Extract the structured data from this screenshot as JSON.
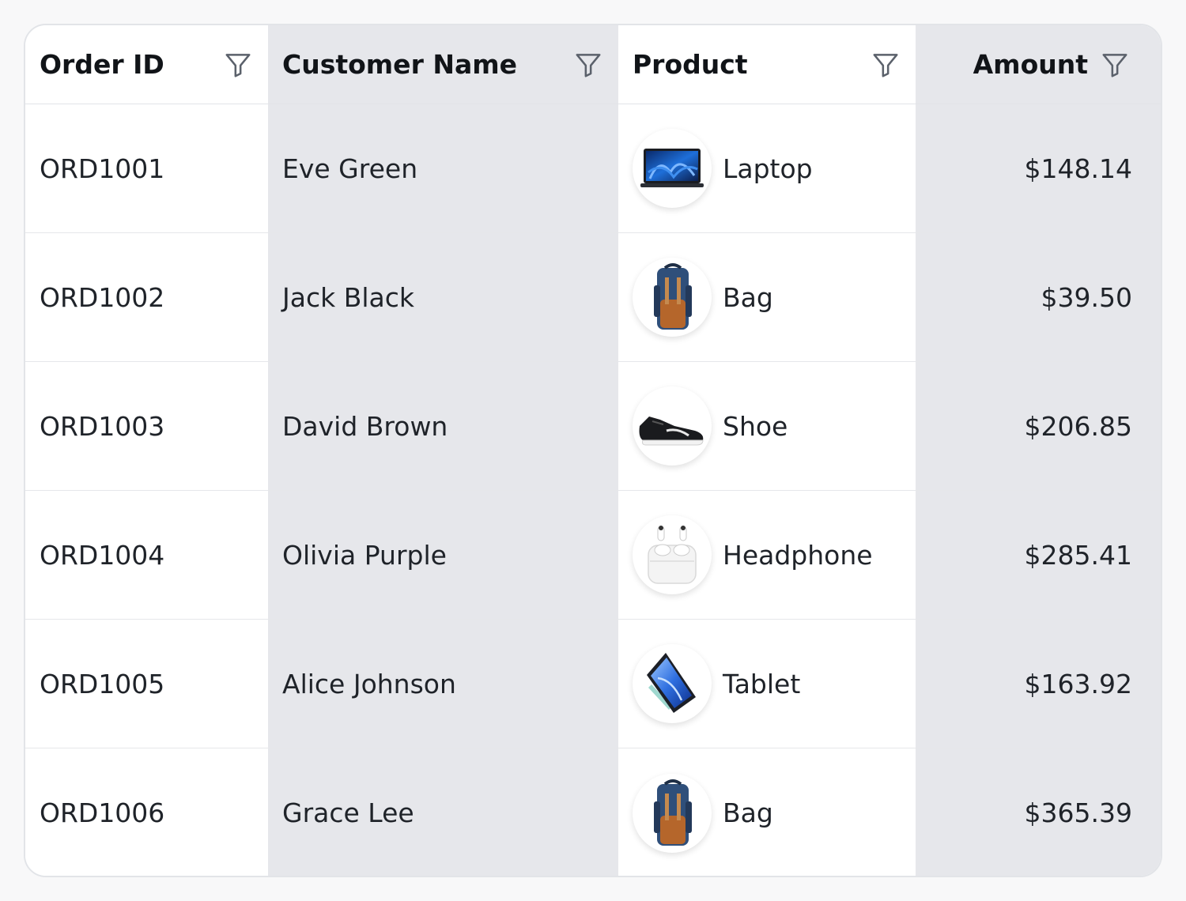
{
  "columns": [
    {
      "label": "Order ID"
    },
    {
      "label": "Customer Name"
    },
    {
      "label": "Product"
    },
    {
      "label": "Amount"
    }
  ],
  "rows": [
    {
      "order_id": "ORD1001",
      "customer": "Eve Green",
      "product": "Laptop",
      "product_icon": "laptop-icon",
      "amount": "$148.14"
    },
    {
      "order_id": "ORD1002",
      "customer": "Jack Black",
      "product": "Bag",
      "product_icon": "backpack-icon",
      "amount": "$39.50"
    },
    {
      "order_id": "ORD1003",
      "customer": "David Brown",
      "product": "Shoe",
      "product_icon": "sneaker-icon",
      "amount": "$206.85"
    },
    {
      "order_id": "ORD1004",
      "customer": "Olivia Purple",
      "product": "Headphone",
      "product_icon": "earbuds-icon",
      "amount": "$285.41"
    },
    {
      "order_id": "ORD1005",
      "customer": "Alice Johnson",
      "product": "Tablet",
      "product_icon": "tablet-icon",
      "amount": "$163.92"
    },
    {
      "order_id": "ORD1006",
      "customer": "Grace Lee",
      "product": "Bag",
      "product_icon": "backpack-icon",
      "amount": "$365.39"
    }
  ],
  "icons": {
    "filter": "filter-icon"
  },
  "colors": {
    "header_text": "#111418",
    "cell_text": "#1f2329",
    "alt_column_bg": "#e6e7eb",
    "border": "#e2e4e8"
  }
}
